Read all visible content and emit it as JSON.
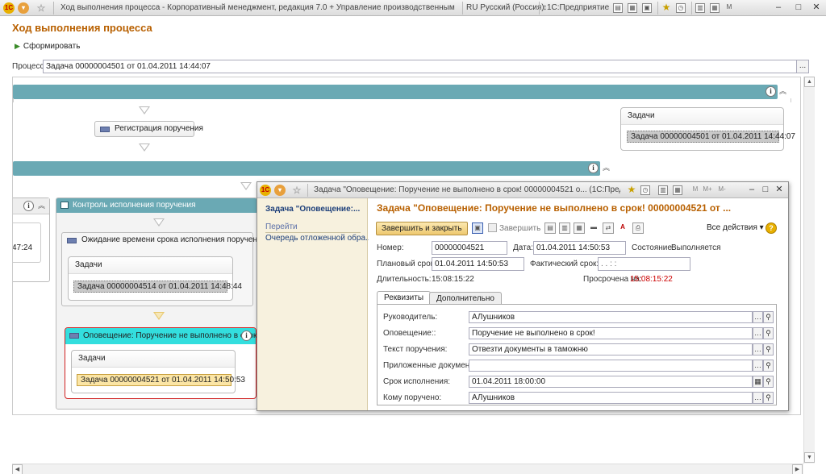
{
  "titlebar": {
    "app_title": "Ход выполнения процесса - Корпоративный менеджмент, редакция 7.0 + Управление производственным предприятием...",
    "language": "RU Русский (Россия)",
    "platform": "1С:Предприятие"
  },
  "page": {
    "title": "Ход выполнения процесса",
    "run_button": "Сформировать",
    "process_label": "Процесс:",
    "process_value": "Задача 00000004501 от 01.04.2011 14:44:07",
    "ellipsis": "..."
  },
  "diagram": {
    "node_registration": "Регистрация поручения",
    "tasks_title": "Задачи",
    "task_registration": "Задача 00000004501 от 01.04.2011 14:44:07",
    "left_partial_time": "47:24",
    "control_group": "Контроль исполнения поручения",
    "node_waiting": "Ожидание времени срока исполнения поручения",
    "task_waiting": "Задача 00000004514 от 01.04.2011 14:48:44",
    "node_notification": "Оповещение: Поручение не выполнено в срок!",
    "task_notification": "Задача 00000004521 от 01.04.2011 14:50:53"
  },
  "modal": {
    "title": "Задача \"Оповещение: Поручение не выполнено в срок!  00000004521 о...  (1С:Предприятие)",
    "side_title": "Задача \"Оповещение:...",
    "side_goto": "Перейти",
    "side_link": "Очередь отложенной обра...",
    "header": "Задача \"Оповещение: Поручение не выполнено в срок!  00000004521 от ...",
    "btn_finish_close": "Завершить и закрыть",
    "btn_finish": "Завершить",
    "btn_all_actions": "Все действия",
    "number_label": "Номер:",
    "number_value": "00000004521",
    "date_label": "Дата:",
    "date_value": "01.04.2011 14:50:53",
    "state_label": "Состояние:",
    "state_value": "Выполняется",
    "plan_label": "Плановый срок:",
    "plan_value": "01.04.2011 14:50:53",
    "fact_label": "Фактический срок:",
    "fact_value": " .  .        :  :",
    "duration_label": "Длительность:",
    "duration_value": "15:08:15:22",
    "overdue_label": "Просрочена на:",
    "overdue_value": "15:08:15:22",
    "tab_requisites": "Реквизиты",
    "tab_additional": "Дополнительно",
    "fields": [
      {
        "label": "Руководитель:",
        "value": "АЛушников"
      },
      {
        "label": "Оповещение::",
        "value": "Поручение не выполнено в срок!"
      },
      {
        "label": "Текст поручения:",
        "value": "Отвезти документы в таможню"
      },
      {
        "label": "Приложенные документы:",
        "value": ""
      },
      {
        "label": "Срок исполнения:",
        "value": "01.04.2011 18:00:00"
      },
      {
        "label": "Кому поручено:",
        "value": "АЛушников"
      }
    ]
  },
  "colors": {
    "title_orange": "#b86000",
    "group_teal": "#6aa9b4",
    "current_cyan": "#33dede",
    "current_border": "#d02020",
    "overdue_red": "#cc0000"
  }
}
